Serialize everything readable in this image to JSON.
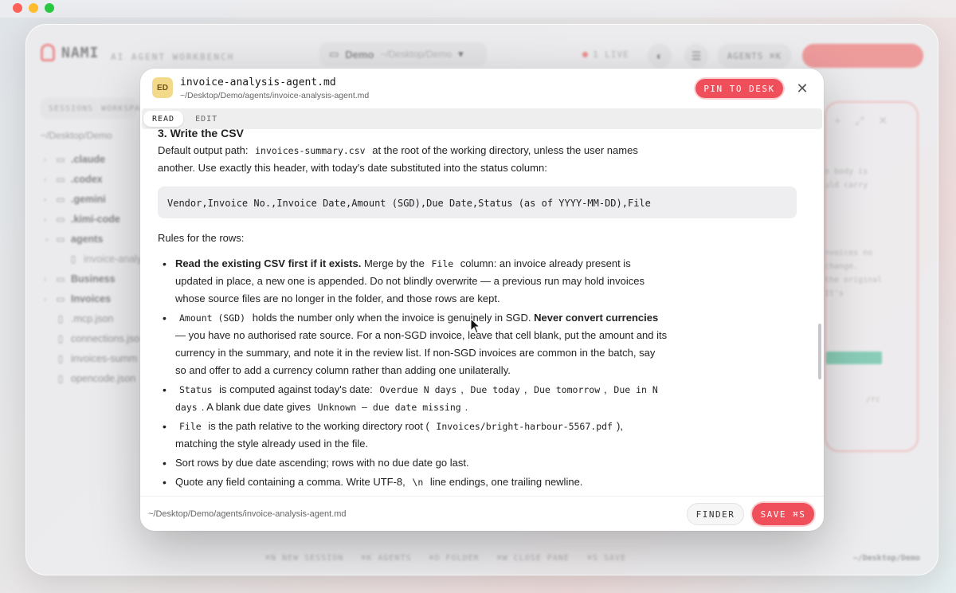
{
  "background": {
    "app_name": "NAMI",
    "app_subtitle": "AI AGENT WORKBENCH",
    "project": {
      "name": "Demo",
      "path": "~/Desktop/Demo"
    },
    "live_label": "1 LIVE",
    "agents_label": "AGENTS ⌘K",
    "sidebar_tabs": [
      "SESSIONS",
      "WORKSPACE"
    ],
    "sidebar_root": "~/Desktop/Demo",
    "tree": [
      {
        "label": ".claude",
        "kind": "folder"
      },
      {
        "label": ".codex",
        "kind": "folder"
      },
      {
        "label": ".gemini",
        "kind": "folder"
      },
      {
        "label": ".kimi-code",
        "kind": "folder"
      },
      {
        "label": "agents",
        "kind": "folder-open"
      },
      {
        "label": "invoice-analy",
        "kind": "child-file"
      },
      {
        "label": "Business",
        "kind": "folder"
      },
      {
        "label": "Invoices",
        "kind": "folder"
      },
      {
        "label": ".mcp.json",
        "kind": "file"
      },
      {
        "label": "connections.jso",
        "kind": "file"
      },
      {
        "label": "invoices-summ",
        "kind": "file"
      },
      {
        "label": "opencode.json",
        "kind": "file"
      }
    ],
    "pane_text_1": "e body is\nuld carry",
    "pane_text_2": "nvoices no\nchange.\nthe original\nIt's",
    "pane_text_3": "/rc",
    "hints": [
      "⌘N NEW SESSION",
      "⌘K AGENTS",
      "⌘O FOLDER",
      "⌘W CLOSE PANE",
      "⌘S SAVE"
    ],
    "bottom_path": "~/Desktop/Demo"
  },
  "modal": {
    "badge": "ED",
    "title": "invoice-analysis-agent.md",
    "path": "~/Desktop/Demo/agents/invoice-analysis-agent.md",
    "pin_label": "PIN TO DESK",
    "close_label": "✕",
    "tabs": {
      "read": "READ",
      "edit": "EDIT"
    },
    "content": {
      "heading_cut": "3. Write the CSV",
      "p1_a": "Default output path:",
      "p1_code": "invoices-summary.csv",
      "p1_b": "at the root of the working directory, unless the user names another. Use exactly this header, with today's date substituted into the status column:",
      "codeblock": "Vendor,Invoice No.,Invoice Date,Amount (SGD),Due Date,Status (as of YYYY-MM-DD),File",
      "rules_label": "Rules for the rows:",
      "r1_bold": "Read the existing CSV first if it exists.",
      "r1_a": "Merge by the",
      "r1_code": "File",
      "r1_b": "column: an invoice already present is updated in place, a new one is appended. Do not blindly overwrite — a previous run may hold invoices whose source files are no longer in the folder, and those rows are kept.",
      "r2_code": "Amount (SGD)",
      "r2_a": "holds the number only when the invoice is genuinely in SGD.",
      "r2_bold": "Never convert currencies",
      "r2_b": "— you have no authorised rate source. For a non-SGD invoice, leave that cell blank, put the amount and its currency in the summary, and note it in the review list. If non-SGD invoices are common in the batch, say so and offer to add a currency column rather than adding one unilaterally.",
      "r3_code": "Status",
      "r3_a": "is computed against today's date:",
      "r3_c1": "Overdue N days",
      "r3_c2": "Due today",
      "r3_c3": "Due tomorrow",
      "r3_c4": "Due in N days",
      "r3_b": ". A blank due date gives",
      "r3_c5": "Unknown — due date missing",
      "r3_end": ".",
      "r4_code": "File",
      "r4_a": "is the path relative to the working directory root (",
      "r4_c2": "Invoices/bright-harbour-5567.pdf",
      "r4_b": "), matching the style already used in the file.",
      "r5": "Sort rows by due date ascending; rows with no due date go last.",
      "r6_a": "Quote any field containing a comma. Write UTF-8,",
      "r6_code": "\\n",
      "r6_b": "line endings, one trailing newline."
    },
    "footer_path": "~/Desktop/Demo/agents/invoice-analysis-agent.md",
    "finder_label": "FINDER",
    "save_label": "SAVE ⌘S"
  },
  "colors": {
    "accent": "#ef4f5b",
    "badge": "#f3d98a",
    "ok": "#3ab58c"
  }
}
